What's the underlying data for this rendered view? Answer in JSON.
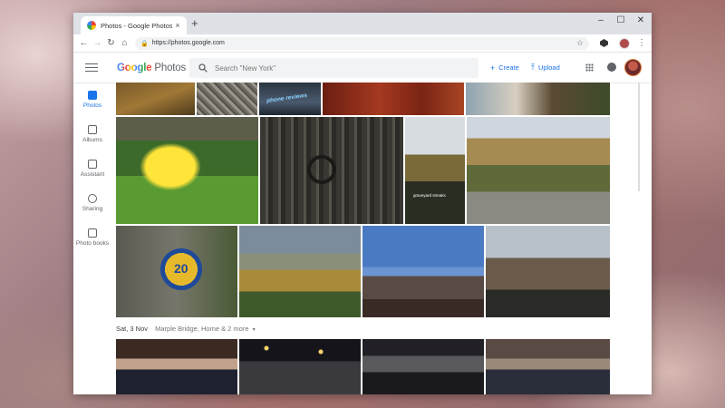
{
  "browser": {
    "tab_title": "Photos - Google Photos",
    "tab_close": "×",
    "new_tab": "+",
    "window_controls": {
      "minimize": "–",
      "maximize": "☐",
      "close": "✕"
    },
    "nav": {
      "back": "←",
      "forward": "→",
      "reload": "↻",
      "home": "⌂"
    },
    "url": "https://photos.google.com",
    "star": "☆",
    "menu": "⋮"
  },
  "app": {
    "logo_google": "Google",
    "logo_photos": "Photos",
    "search_placeholder": "Search \"New York\"",
    "create_label": "Create",
    "upload_label": "Upload"
  },
  "sidebar": {
    "items": [
      {
        "label": "Photos",
        "icon": "photos-icon",
        "active": true
      },
      {
        "label": "Albums",
        "icon": "albums-icon",
        "active": false
      },
      {
        "label": "Assistant",
        "icon": "assistant-icon",
        "active": false
      },
      {
        "label": "Sharing",
        "icon": "sharing-icon",
        "active": false
      },
      {
        "label": "Photo books",
        "icon": "photo-books-icon",
        "active": false
      }
    ]
  },
  "content": {
    "date_header": "Sat, 3 Nov",
    "location": "Marple Bridge, Home & 2 more",
    "overlay_text_1": "phone reviews",
    "overlay_text_2": "graveyard streaks",
    "door_number": "20"
  },
  "colors": {
    "accent": "#1a73e8",
    "google_blue": "#4285f4",
    "google_red": "#ea4335",
    "google_yellow": "#fbbc05",
    "google_green": "#34a853"
  }
}
